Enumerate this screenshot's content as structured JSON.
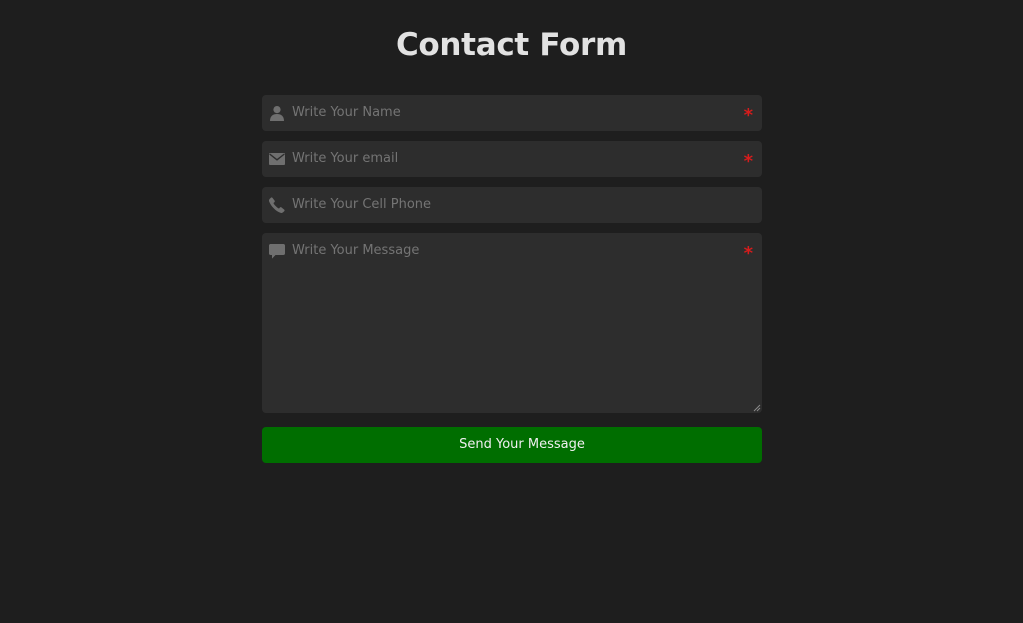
{
  "page": {
    "title": "Contact Form"
  },
  "form": {
    "name": {
      "icon": "user-icon",
      "placeholder": "Write Your Name",
      "value": "",
      "required_mark": "*"
    },
    "email": {
      "icon": "envelope-icon",
      "placeholder": "Write Your email",
      "value": "",
      "required_mark": "*"
    },
    "phone": {
      "icon": "phone-icon",
      "placeholder": "Write Your Cell Phone",
      "value": ""
    },
    "message": {
      "icon": "comment-icon",
      "placeholder": "Write Your Message",
      "value": "",
      "required_mark": "*"
    },
    "submit_label": "Send Your Message"
  },
  "colors": {
    "background": "#1e1e1e",
    "field_background": "#2d2d2d",
    "title": "#e2e2e2",
    "placeholder": "#747474",
    "icon": "#6f6f6f",
    "required": "#d61c1c",
    "submit_background": "#006e00",
    "submit_text": "#f0f0f0"
  }
}
